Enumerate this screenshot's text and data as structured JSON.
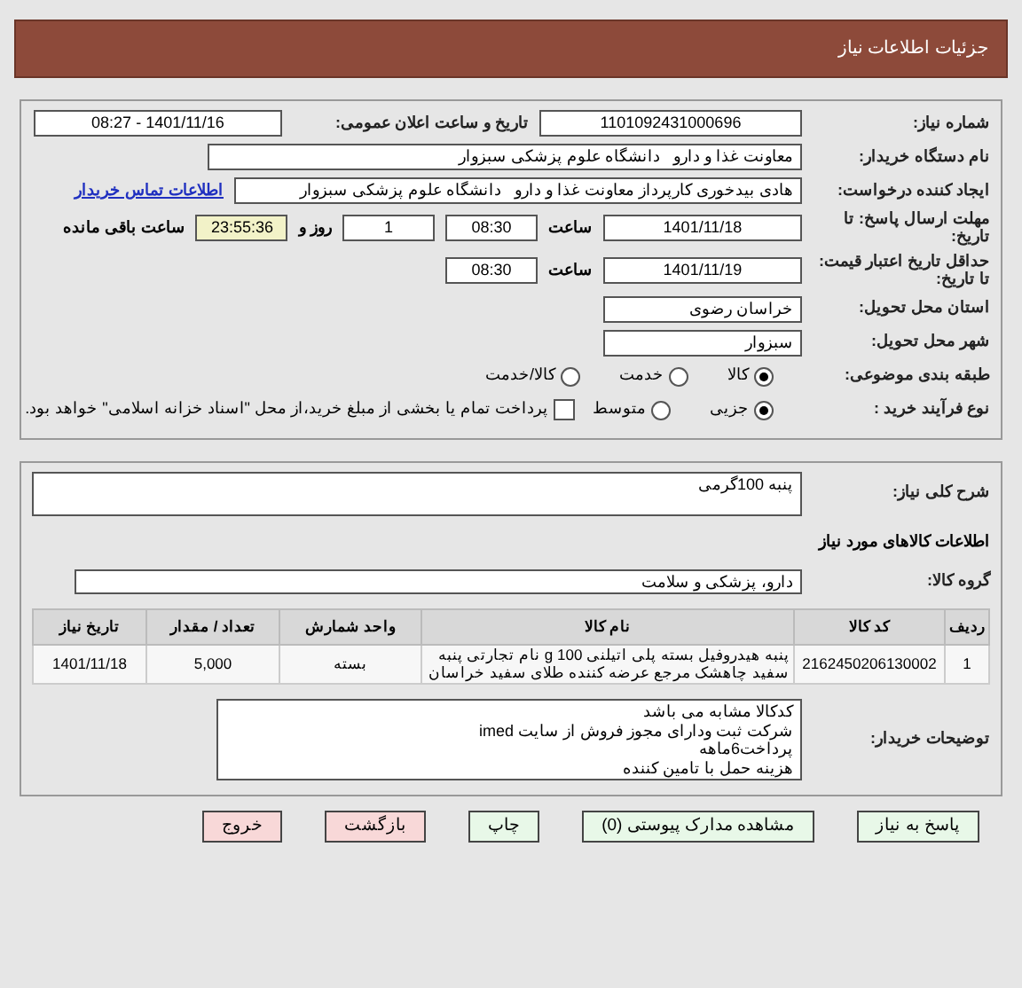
{
  "header": {
    "title": "جزئیات اطلاعات نیاز"
  },
  "details": {
    "need_number": {
      "label": "شماره نیاز:",
      "value": "1101092431000696"
    },
    "announce": {
      "label": "تاریخ و ساعت اعلان عمومی:",
      "value": "1401/11/16 - 08:27"
    },
    "buyer": {
      "label": "نام دستگاه خریدار:",
      "value": "معاونت غذا و دارو   دانشگاه علوم پزشکی سبزوار"
    },
    "creator": {
      "label": "ایجاد کننده درخواست:",
      "value": "هادی بیدخوری کارپرداز معاونت غذا و دارو   دانشگاه علوم پزشکی سبزوار",
      "link": "اطلاعات تماس خریدار"
    },
    "deadline": {
      "label": "مهلت ارسال پاسخ: تا تاریخ:",
      "date": "1401/11/18",
      "time_label": "ساعت",
      "time": "08:30",
      "days": "1",
      "days_label": "روز و",
      "remaining": "23:55:36",
      "remaining_label": "ساعت باقی مانده"
    },
    "validity": {
      "label": "حداقل تاریخ اعتبار قیمت: تا تاریخ:",
      "date": "1401/11/19",
      "time_label": "ساعت",
      "time": "08:30"
    },
    "province": {
      "label": "استان محل تحویل:",
      "value": "خراسان رضوی"
    },
    "city": {
      "label": "شهر محل تحویل:",
      "value": "سبزوار"
    },
    "category": {
      "label": "طبقه بندی موضوعی:",
      "options": [
        {
          "label": "کالا",
          "selected": true
        },
        {
          "label": "خدمت",
          "selected": false
        },
        {
          "label": "کالا/خدمت",
          "selected": false
        }
      ]
    },
    "process": {
      "label": "نوع فرآیند خرید :",
      "options": [
        {
          "label": "جزیی",
          "selected": true
        },
        {
          "label": "متوسط",
          "selected": false
        }
      ],
      "treasury": {
        "label": "پرداخت تمام یا بخشی از مبلغ خرید،از محل \"اسناد خزانه اسلامی\" خواهد بود.",
        "checked": false
      }
    }
  },
  "goods": {
    "description": {
      "label": "شرح کلی نیاز:",
      "value": "پنبه 100گرمی"
    },
    "section_title": "اطلاعات کالاهای مورد نیاز",
    "group": {
      "label": "گروه کالا:",
      "value": "دارو، پزشکی و سلامت"
    },
    "table": {
      "columns": [
        "ردیف",
        "کد کالا",
        "نام کالا",
        "واحد شمارش",
        "تعداد / مقدار",
        "تاریخ نیاز"
      ],
      "rows": [
        [
          "1",
          "2162450206130002",
          "پنبه هیدروفیل بسته پلی اتیلنی 100 g نام تجارتی پنبه سفید چاهشک مرجع عرضه کننده طلای سفید خراسان",
          "بسته",
          "5,000",
          "1401/11/18"
        ]
      ]
    },
    "notes": {
      "label": "توضیحات خریدار:",
      "lines": [
        "کدکالا مشابه می باشد",
        "شرکت ثبت ودارای مجوز فروش از سایت imed",
        "پرداخت6ماهه",
        "هزینه حمل با تامین کننده"
      ]
    }
  },
  "buttons": [
    {
      "label": "پاسخ به نیاز",
      "kind": "action"
    },
    {
      "label": "مشاهده مدارک پیوستی (0)",
      "kind": "action"
    },
    {
      "label": "چاپ",
      "kind": "action"
    },
    {
      "label": "بازگشت",
      "kind": "exit"
    },
    {
      "label": "خروج",
      "kind": "exit"
    }
  ]
}
